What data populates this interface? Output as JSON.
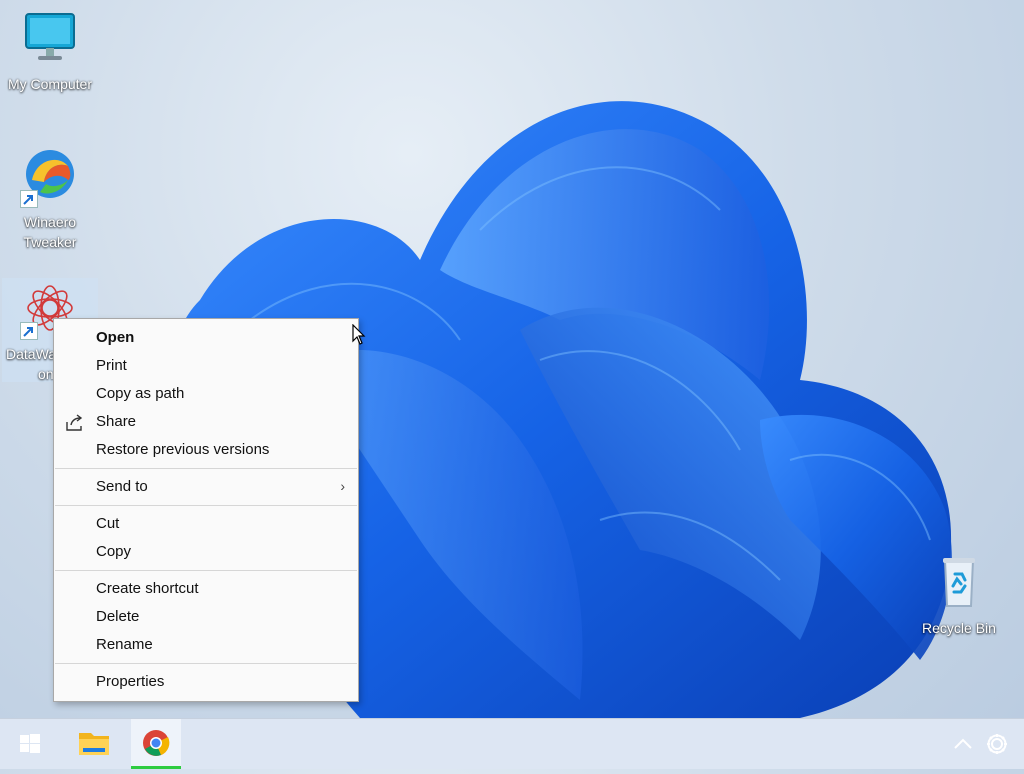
{
  "desktop": {
    "icons": [
      {
        "label": "My Computer"
      },
      {
        "label_line1": "Winaero",
        "label_line2": "Tweaker"
      },
      {
        "label_line1": "DataWa",
        "label_line2": "on"
      },
      {
        "label": "Recycle Bin"
      }
    ]
  },
  "context_menu": {
    "items": [
      {
        "label": "Open"
      },
      {
        "label": "Print"
      },
      {
        "label": "Copy as path"
      },
      {
        "label": "Share"
      },
      {
        "label": "Restore previous versions"
      },
      {
        "label": "Send to"
      },
      {
        "label": "Cut"
      },
      {
        "label": "Copy"
      },
      {
        "label": "Create shortcut"
      },
      {
        "label": "Delete"
      },
      {
        "label": "Rename"
      },
      {
        "label": "Properties"
      }
    ]
  },
  "colors": {
    "taskbar": "#dde6f3",
    "wallpaper_bloom": "#1a6cf0",
    "chrome_active_indicator": "#2ecc40"
  },
  "taskbar": {
    "items": [
      {
        "icon": "windows-start-icon"
      },
      {
        "icon": "file-explorer-icon"
      },
      {
        "icon": "chrome-icon",
        "active": true
      }
    ],
    "tray": [
      {
        "icon": "chevron-up-icon"
      },
      {
        "icon": "gear-icon"
      }
    ]
  }
}
